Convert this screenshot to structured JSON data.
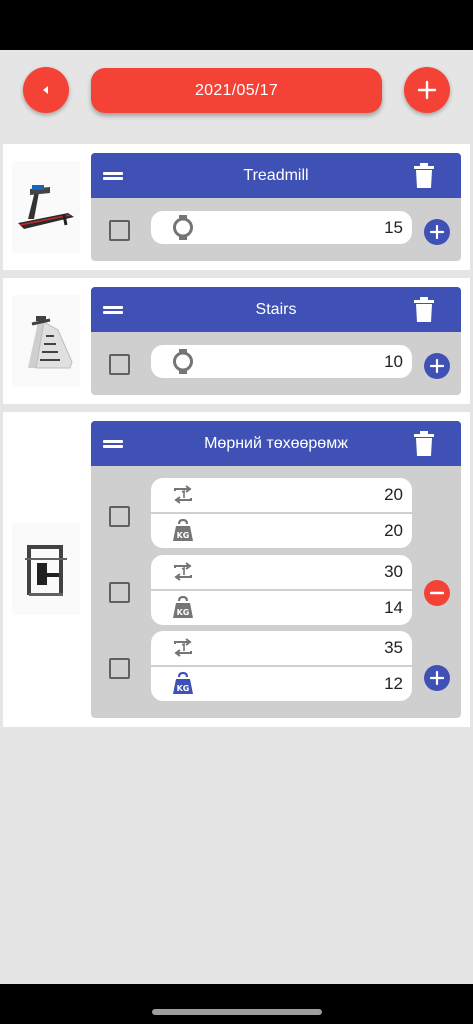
{
  "header": {
    "date": "2021/05/17",
    "back_icon": "caret-left-icon",
    "add_icon": "plus-icon"
  },
  "colors": {
    "accent_red": "#f44336",
    "primary_blue": "#3f51b5",
    "panel_grey": "#cfcfcf",
    "background": "#e5e5e5"
  },
  "exercises": [
    {
      "title": "Treadmill",
      "image": "treadmill",
      "sets": [
        {
          "type": "time",
          "value": "15",
          "icon": "stopwatch-icon"
        }
      ]
    },
    {
      "title": "Stairs",
      "image": "stair-climber",
      "sets": [
        {
          "type": "time",
          "value": "10",
          "icon": "stopwatch-icon"
        }
      ]
    },
    {
      "title": "Мөрний төхөөрөмж",
      "image": "shoulder-press-machine",
      "sets": [
        {
          "reps": "20",
          "weight": "20",
          "reps_icon": "repeat-one-icon",
          "weight_icon": "kettlebell-kg-icon"
        },
        {
          "reps": "30",
          "weight": "14",
          "reps_icon": "repeat-one-icon",
          "weight_icon": "kettlebell-kg-icon"
        },
        {
          "reps": "35",
          "weight": "12",
          "reps_icon": "repeat-one-icon",
          "weight_icon": "kettlebell-kg-icon"
        }
      ]
    }
  ]
}
